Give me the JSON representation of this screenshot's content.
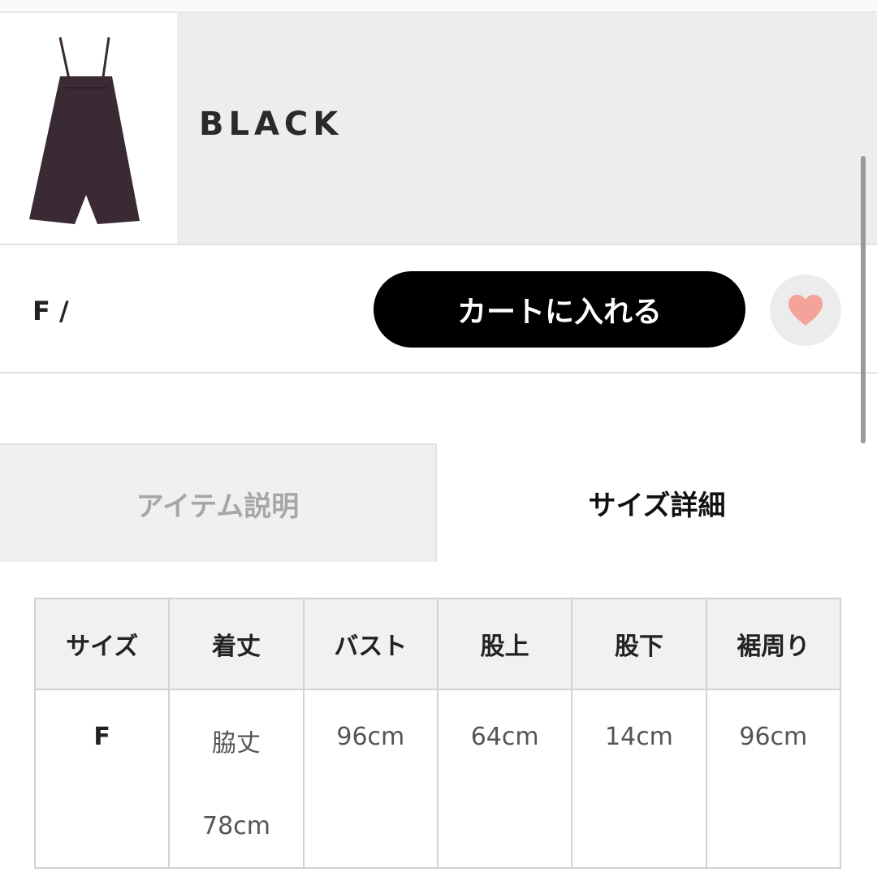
{
  "product": {
    "color_name": "BLACK",
    "size_label": "F /",
    "cart_button_label": "カートに入れる",
    "favorite_icon": "heart-icon"
  },
  "tabs": [
    {
      "label": "アイテム説明",
      "active": false
    },
    {
      "label": "サイズ詳細",
      "active": true
    }
  ],
  "size_table": {
    "headers": [
      "サイズ",
      "着丈",
      "バスト",
      "股上",
      "股下",
      "裾周り"
    ],
    "rows": [
      {
        "size": "F",
        "length_line1": "脇丈",
        "length_line2": "78cm",
        "bust": "96cm",
        "rise": "64cm",
        "inseam": "14cm",
        "hem": "96cm"
      }
    ]
  },
  "colors": {
    "accent_button": "#000000",
    "heart": "#f4a39a",
    "panel_gray": "#ededed",
    "garment": "#3a2a33"
  }
}
